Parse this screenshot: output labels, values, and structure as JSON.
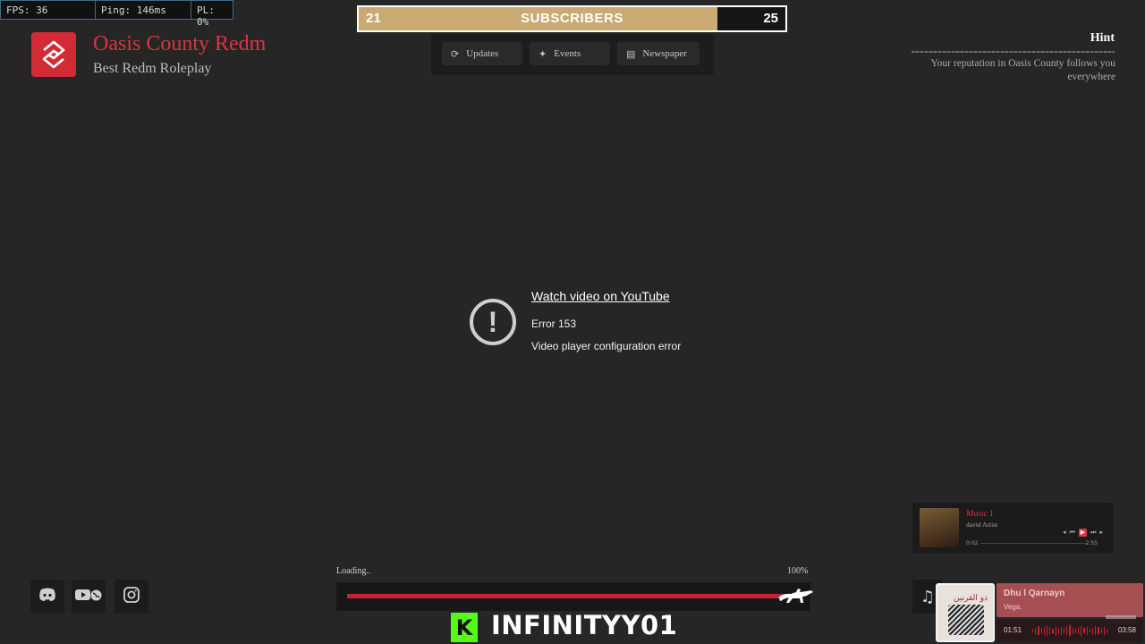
{
  "debug": {
    "fps": "FPS: 36",
    "ping": "Ping: 146ms",
    "pl": "PL: 0%"
  },
  "brand": {
    "title": "Oasis County Redm",
    "subtitle": "Best Redm Roleplay",
    "logo_icon": "s-emblem-icon"
  },
  "subscribers": {
    "current": "21",
    "label": "SUBSCRIBERS",
    "goal": "25",
    "progress_fraction": 0.84,
    "accent": "#c8aa72"
  },
  "topnav": [
    {
      "label": "Updates",
      "icon": "refresh-icon"
    },
    {
      "label": "Events",
      "icon": "sparkle-icon"
    },
    {
      "label": "Newspaper",
      "icon": "newspaper-icon"
    }
  ],
  "hint": {
    "title": "Hint",
    "text": "Your reputation in Oasis County follows you everywhere"
  },
  "video_error": {
    "link": "Watch video on YouTube",
    "code": "Error 153",
    "message": "Video player configuration error"
  },
  "social": [
    {
      "icon": "discord-icon"
    },
    {
      "icon": "youtube-globe-icon"
    },
    {
      "icon": "instagram-icon"
    }
  ],
  "loading": {
    "label": "Loading..",
    "percent": "100%",
    "progress_fraction": 1.0,
    "color": "#c4242f"
  },
  "streamer": {
    "platform_icon": "kick-icon",
    "name": "INFINITYY01"
  },
  "music_card": {
    "title": "Music 1",
    "artist": "david Artist",
    "elapsed": "0:02",
    "duration": "2:55"
  },
  "now_playing": {
    "title": "Dhu l Qarnayn",
    "artist": "Vega.",
    "elapsed": "01:51",
    "duration": "03:58"
  }
}
